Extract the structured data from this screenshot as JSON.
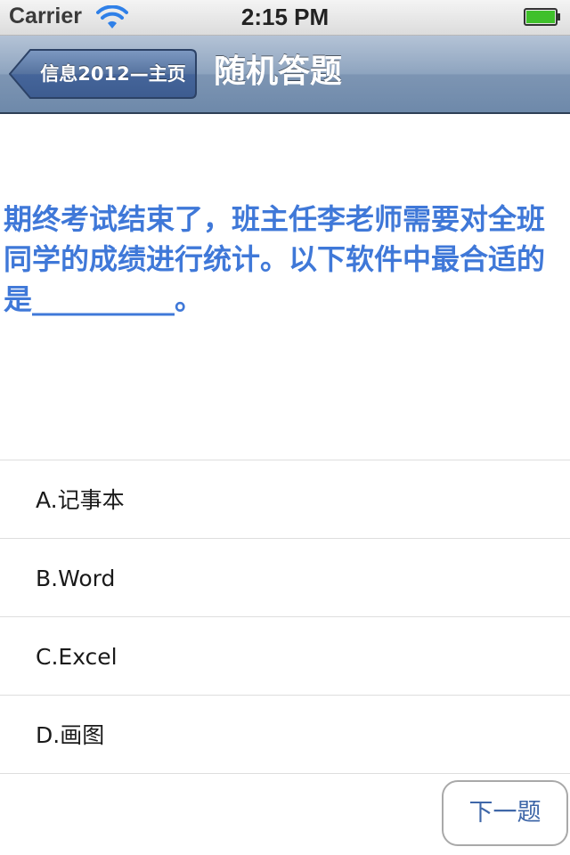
{
  "status_bar": {
    "carrier": "Carrier",
    "time": "2:15 PM",
    "wifi_icon": "wifi-icon",
    "battery_icon": "battery-icon",
    "battery_color": "#3fc02b"
  },
  "nav": {
    "back_label": "信息2012—主页",
    "title": "随机答题"
  },
  "question": {
    "text": "期终考试结束了，班主任李老师需要对全班同学的成绩进行统计。以下软件中最合适的是__________。",
    "color": "#3f78d8"
  },
  "options": [
    {
      "label": "A.记事本"
    },
    {
      "label": "B.Word"
    },
    {
      "label": "C.Excel"
    },
    {
      "label": "D.画图"
    }
  ],
  "next_button": {
    "label": "下一题"
  }
}
